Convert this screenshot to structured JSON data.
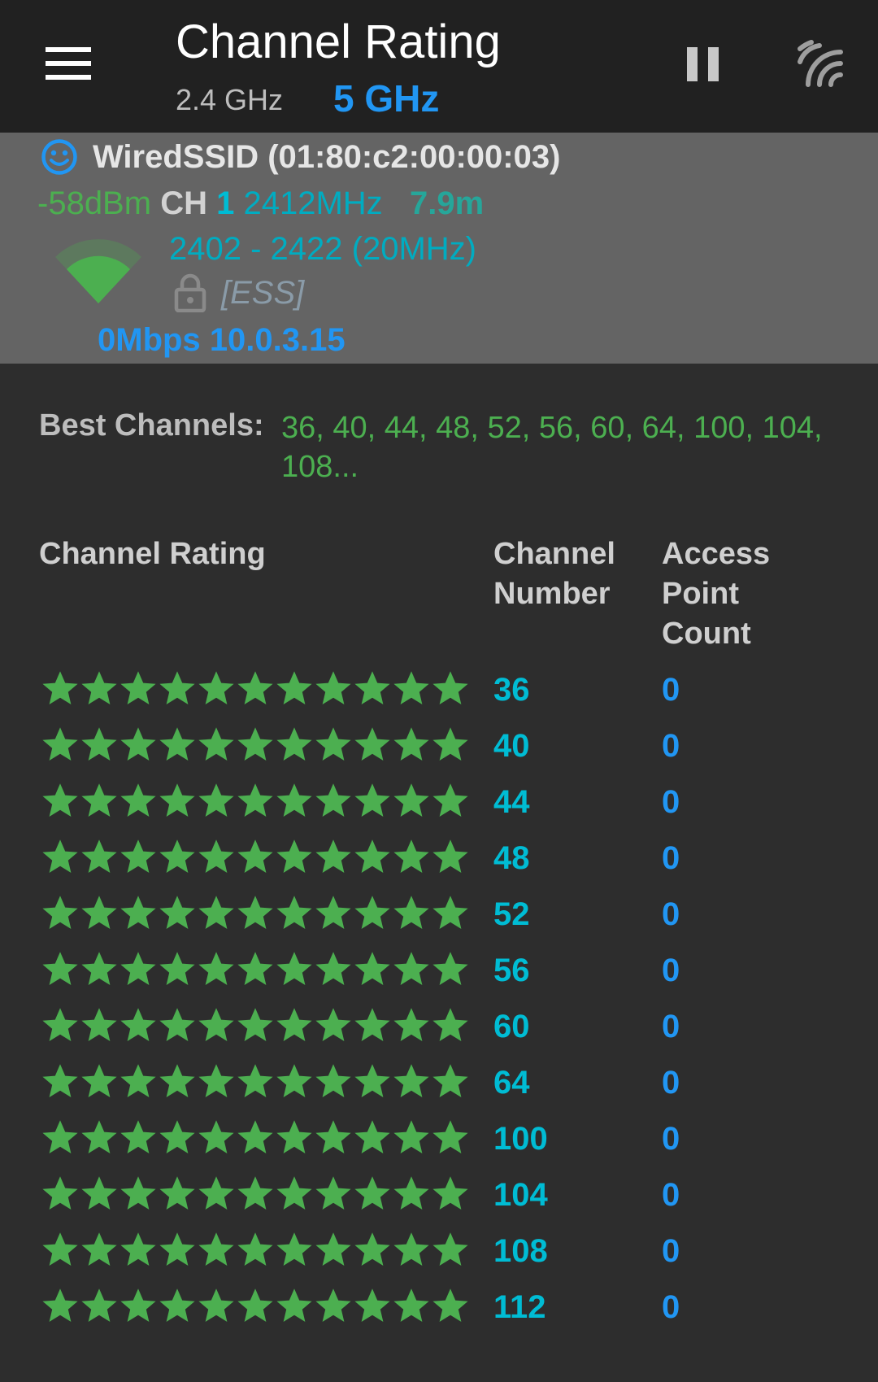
{
  "header": {
    "title": "Channel Rating",
    "tabs": [
      {
        "label": "2.4 GHz",
        "selected": false
      },
      {
        "label": "5 GHz",
        "selected": true
      }
    ],
    "icons": [
      "menu-icon",
      "pause-icon",
      "wifi-off-icon"
    ]
  },
  "connection": {
    "ssid": "WiredSSID (01:80:c2:00:00:03)",
    "signal": "-58dBm",
    "ch_label": "CH",
    "channel": "1",
    "frequency": "2412MHz",
    "distance": "7.9m",
    "range": "2402 - 2422 (20MHz)",
    "capabilities": "[ESS]",
    "speed": "0Mbps",
    "ip": "10.0.3.15",
    "icons": [
      "smile-icon",
      "wifi-signal-icon",
      "lock-icon"
    ]
  },
  "best_channels": {
    "label": "Best Channels:",
    "values": "36, 40, 44, 48, 52, 56, 60, 64, 100, 104, 108..."
  },
  "table": {
    "columns": [
      "Channel Rating",
      "Channel Number",
      "Access Point Count"
    ],
    "rows": [
      {
        "rating": 10,
        "channel": "36",
        "count": "0"
      },
      {
        "rating": 10,
        "channel": "40",
        "count": "0"
      },
      {
        "rating": 10,
        "channel": "44",
        "count": "0"
      },
      {
        "rating": 10,
        "channel": "48",
        "count": "0"
      },
      {
        "rating": 10,
        "channel": "52",
        "count": "0"
      },
      {
        "rating": 10,
        "channel": "56",
        "count": "0"
      },
      {
        "rating": 10,
        "channel": "60",
        "count": "0"
      },
      {
        "rating": 10,
        "channel": "64",
        "count": "0"
      },
      {
        "rating": 10,
        "channel": "100",
        "count": "0"
      },
      {
        "rating": 10,
        "channel": "104",
        "count": "0"
      },
      {
        "rating": 10,
        "channel": "108",
        "count": "0"
      },
      {
        "rating": 10,
        "channel": "112",
        "count": "0"
      }
    ]
  },
  "colors": {
    "appbar": "#212121",
    "background": "#2d2d2d",
    "connection_panel": "#646464",
    "star": "#4caf50",
    "accent_blue": "#2196f3",
    "accent_cyan": "#00bcd4"
  }
}
